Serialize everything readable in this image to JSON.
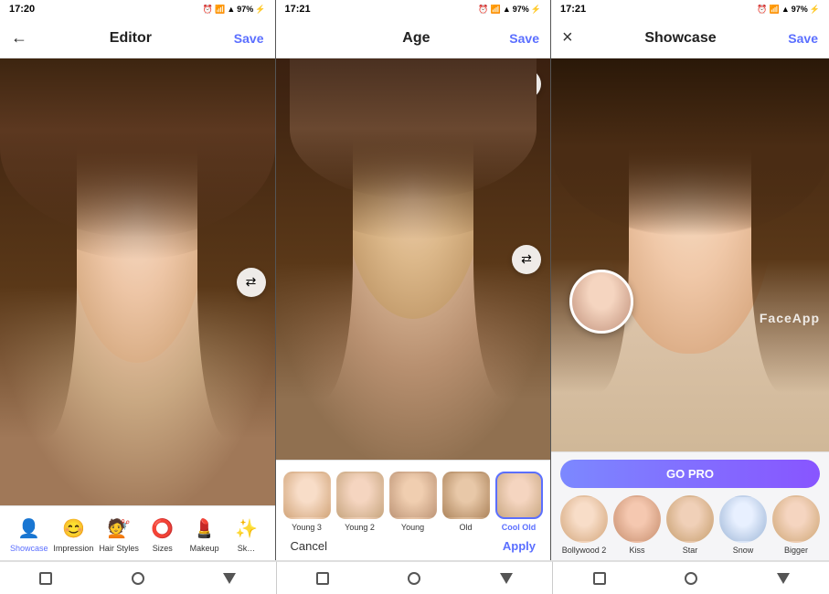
{
  "screens": [
    {
      "id": "editor",
      "statusTime": "17:20",
      "statusBattery": "97%",
      "topBar": {
        "back": "←",
        "title": "Editor",
        "save": "Save"
      },
      "bottomNav": [
        {
          "label": "Showcase",
          "icon": "👤",
          "active": true
        },
        {
          "label": "Impression",
          "icon": "😊",
          "active": false
        },
        {
          "label": "Hair Styles",
          "icon": "💇",
          "active": false
        },
        {
          "label": "Sizes",
          "icon": "⭕",
          "active": false
        },
        {
          "label": "Makeup",
          "icon": "💄",
          "active": false
        },
        {
          "label": "Sk…",
          "icon": "✨",
          "active": false
        }
      ]
    },
    {
      "id": "age",
      "statusTime": "17:21",
      "statusBattery": "97%",
      "topBar": {
        "title": "Age",
        "save": "Save"
      },
      "filters": [
        {
          "label": "Young 3",
          "thumb": "thumb-young3",
          "selected": false
        },
        {
          "label": "Young 2",
          "thumb": "thumb-young2",
          "selected": false
        },
        {
          "label": "Young",
          "thumb": "thumb-young",
          "selected": false
        },
        {
          "label": "Old",
          "thumb": "thumb-old",
          "selected": false
        },
        {
          "label": "Cool Old",
          "thumb": "thumb-coolold",
          "selected": true
        }
      ],
      "cancelLabel": "Cancel",
      "applyLabel": "Apply"
    },
    {
      "id": "showcase",
      "statusTime": "17:21",
      "statusBattery": "97%",
      "topBar": {
        "close": "×",
        "title": "Showcase",
        "save": "Save"
      },
      "goProLabel": "GO PRO",
      "watermark": "FaceApp",
      "showcaseFilters": [
        {
          "label": "Bollywood 2",
          "thumb": "s-thumb-bollywood",
          "active": false
        },
        {
          "label": "Kiss",
          "thumb": "s-thumb-kiss",
          "active": false
        },
        {
          "label": "Star",
          "thumb": "s-thumb-star",
          "active": false
        },
        {
          "label": "Snow",
          "thumb": "s-thumb-snow",
          "active": false
        },
        {
          "label": "Bigger",
          "thumb": "s-thumb-bigger",
          "active": false
        }
      ]
    }
  ],
  "sysNav": {
    "buttons": [
      "square",
      "circle",
      "triangle"
    ]
  }
}
